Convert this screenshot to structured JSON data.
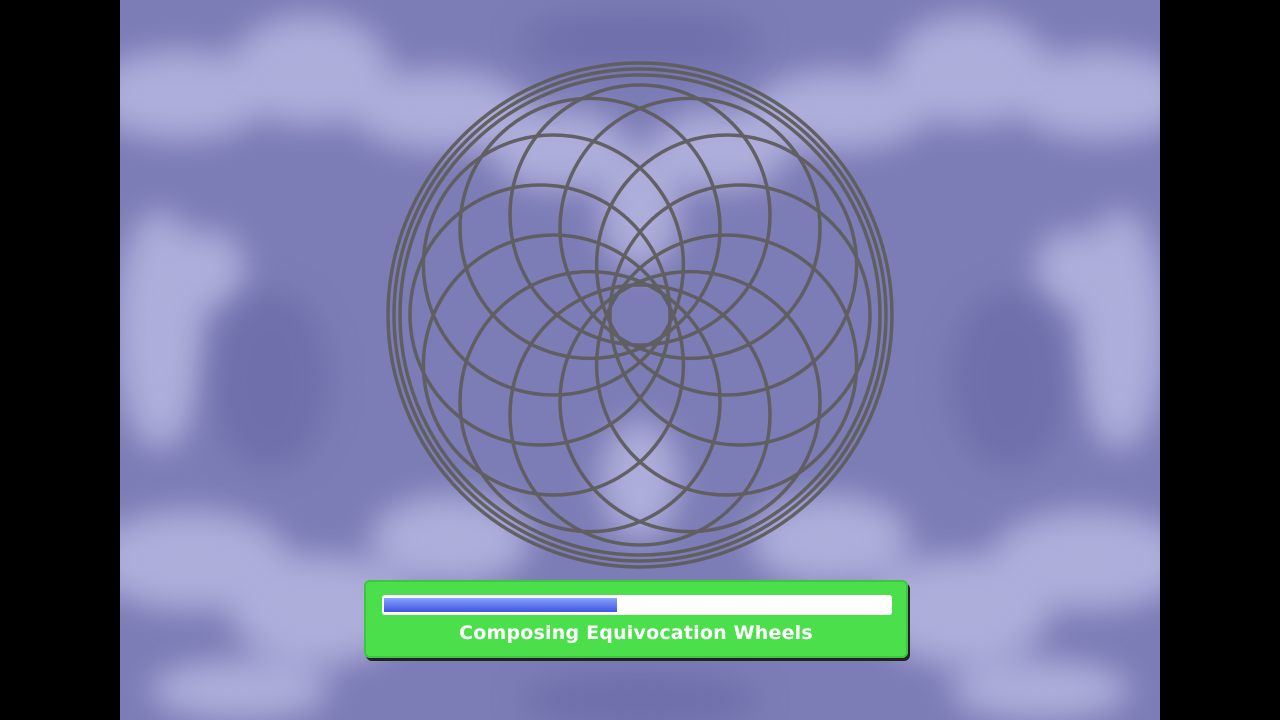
{
  "loading": {
    "status_text": "Composing Equivocation Wheels",
    "progress": 0.46
  },
  "colors": {
    "background": "#7c7cb6",
    "cloud": "#b4b4e0",
    "wheel": "#5a5a5a",
    "panel": "#4be04b",
    "bar_fill": "#3c54e0"
  },
  "icons": {
    "center_graphic": "spirograph-wheel-icon"
  }
}
